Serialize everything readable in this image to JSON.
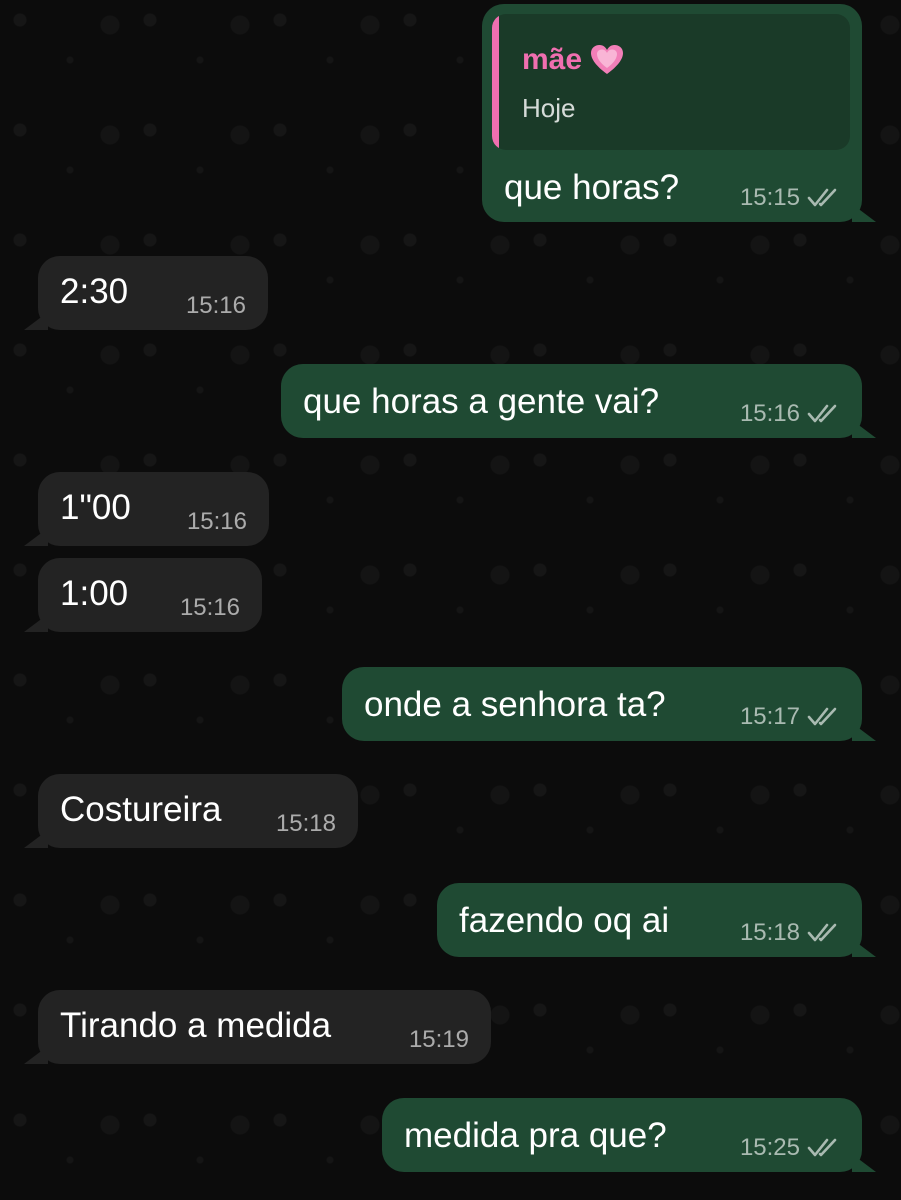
{
  "chat": {
    "messages": [
      {
        "direction": "out",
        "text": "que horas?",
        "time": "15:15",
        "read_ticks": "double-check-icon",
        "reply": {
          "author": "mãe",
          "author_emoji": "pink-heart-icon",
          "text": "Hoje"
        }
      },
      {
        "direction": "in",
        "text": "2:30",
        "time": "15:16"
      },
      {
        "direction": "out",
        "text": "que horas a gente vai?",
        "time": "15:16",
        "read_ticks": "double-check-icon"
      },
      {
        "direction": "in",
        "text": "1\"00",
        "time": "15:16"
      },
      {
        "direction": "in",
        "text": "1:00",
        "time": "15:16"
      },
      {
        "direction": "out",
        "text": "onde a senhora ta?",
        "time": "15:17",
        "read_ticks": "double-check-icon"
      },
      {
        "direction": "in",
        "text": "Costureira",
        "time": "15:18"
      },
      {
        "direction": "out",
        "text": "fazendo oq ai",
        "time": "15:18",
        "read_ticks": "double-check-icon"
      },
      {
        "direction": "in",
        "text": "Tirando a medida",
        "time": "15:19"
      },
      {
        "direction": "out",
        "text": "medida pra que?",
        "time": "15:25",
        "read_ticks": "double-check-icon"
      }
    ]
  },
  "colors": {
    "outgoing_bubble": "#1f4a33",
    "incoming_bubble": "#232323",
    "reply_author": "#f06fb0",
    "background": "#0c0c0c"
  }
}
